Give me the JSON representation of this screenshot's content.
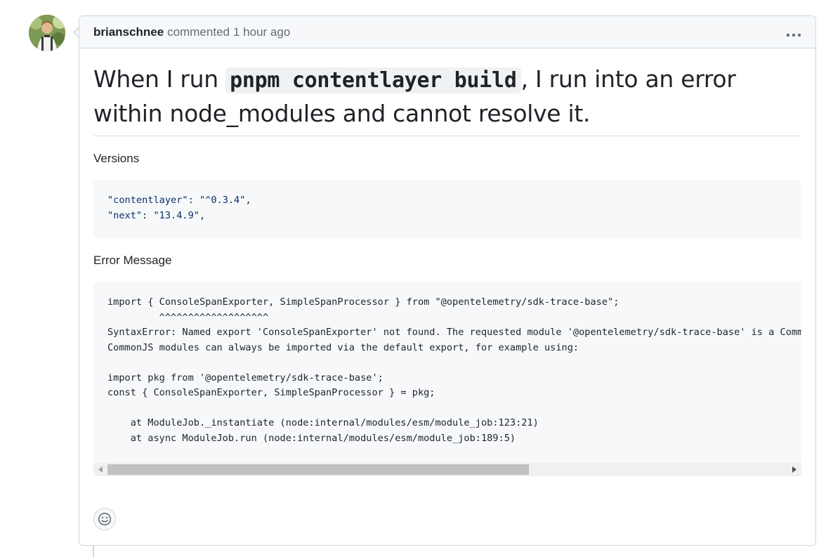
{
  "comment": {
    "author": "brianschnee",
    "action": "commented",
    "time": "1 hour ago",
    "menu_icon": "kebab-horizontal-icon"
  },
  "heading": {
    "before": "When I run ",
    "code": "pnpm contentlayer build",
    "after": ", I run into an error within node_modules and cannot resolve it."
  },
  "versions": {
    "label": "Versions",
    "line1_key": "\"contentlayer\"",
    "line1_val": "\"^0.3.4\"",
    "line2_key": "\"next\"",
    "line2_val": "\"13.4.9\""
  },
  "error": {
    "label": "Error Message",
    "lines": [
      "import { ConsoleSpanExporter, SimpleSpanProcessor } from \"@opentelemetry/sdk-trace-base\";",
      "         ^^^^^^^^^^^^^^^^^^^",
      "SyntaxError: Named export 'ConsoleSpanExporter' not found. The requested module '@opentelemetry/sdk-trace-base' is a CommonJS module, which may not support all module.exports as named exports.",
      "CommonJS modules can always be imported via the default export, for example using:",
      "",
      "import pkg from '@opentelemetry/sdk-trace-base';",
      "const { ConsoleSpanExporter, SimpleSpanProcessor } = pkg;",
      "",
      "    at ModuleJob._instantiate (node:internal/modules/esm/module_job:123:21)",
      "    at async ModuleJob.run (node:internal/modules/esm/module_job:189:5)"
    ],
    "scroll_position": 0.62
  },
  "reaction_icon": "smiley-icon"
}
